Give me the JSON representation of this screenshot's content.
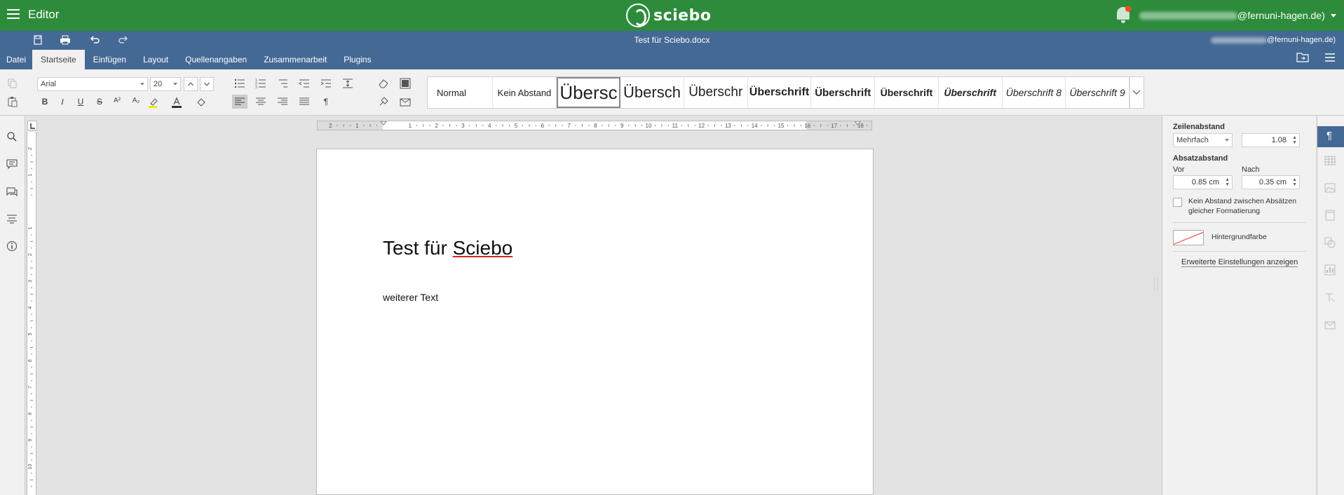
{
  "app": {
    "title": "Editor"
  },
  "brand": {
    "logo_text": "sciebo",
    "logo_color": "#2d8c3b"
  },
  "account": {
    "email_suffix": "@fernuni-hagen.de)"
  },
  "document": {
    "title": "Test für Sciebo.docx",
    "user_suffix": "@fernuni-hagen.de)"
  },
  "tabs": [
    {
      "label": "Datei"
    },
    {
      "label": "Startseite"
    },
    {
      "label": "Einfügen"
    },
    {
      "label": "Layout"
    },
    {
      "label": "Quellenangaben"
    },
    {
      "label": "Zusammenarbeit"
    },
    {
      "label": "Plugins"
    }
  ],
  "toolbar": {
    "font_name": "Arial",
    "font_size": "20",
    "bold": "B",
    "italic": "I",
    "underline": "U",
    "strike": "S",
    "superscript": "A²",
    "subscript": "A₂",
    "paragraph_mark": "¶"
  },
  "styles": [
    {
      "label": "Normal"
    },
    {
      "label": "Kein Abstand"
    },
    {
      "label": "Übersc"
    },
    {
      "label": "Übersch"
    },
    {
      "label": "Überschr"
    },
    {
      "label": "Überschrift"
    },
    {
      "label": "Überschrift"
    },
    {
      "label": "Überschrift"
    },
    {
      "label": "Überschrift"
    },
    {
      "label": "Überschrift 8"
    },
    {
      "label": "Überschrift 9"
    }
  ],
  "ruler": {
    "marks": [
      "2",
      "1",
      "1",
      "2",
      "3",
      "4",
      "5",
      "6",
      "7",
      "8",
      "9",
      "10",
      "11",
      "12",
      "13",
      "14",
      "15",
      "16",
      "17",
      "18"
    ]
  },
  "vruler": {
    "marks": [
      "2",
      "1",
      "1",
      "2",
      "3",
      "4",
      "5",
      "6",
      "7",
      "8",
      "9",
      "10"
    ]
  },
  "page": {
    "heading_plain": "Test für ",
    "heading_misspelled": "Sciebo",
    "body": "weiterer Text"
  },
  "paragraph_settings": {
    "line_spacing_label": "Zeilenabstand",
    "line_spacing_mode": "Mehrfach",
    "line_spacing_value": "1.08",
    "para_spacing_label": "Absatzabstand",
    "before_label": "Vor",
    "before_value": "0.85 cm",
    "after_label": "Nach",
    "after_value": "0.35 cm",
    "no_spacing_label_1": "Kein Abstand zwischen Absätzen",
    "no_spacing_label_2": "gleicher Formatierung",
    "background_label": "Hintergrundfarbe",
    "advanced_link": "Erweiterte Einstellungen anzeigen"
  },
  "colors": {
    "accent_blue": "#446995",
    "header_green": "#2d8c3b"
  }
}
